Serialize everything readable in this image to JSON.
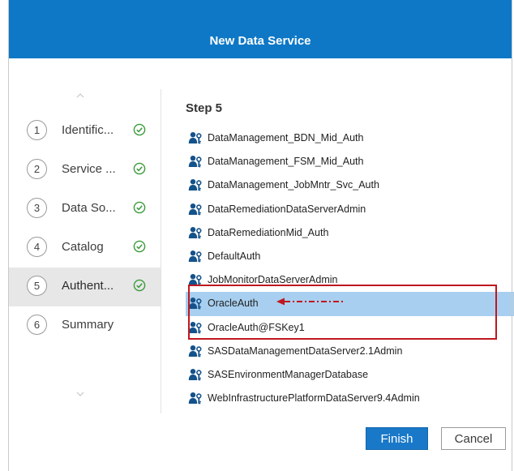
{
  "dialog": {
    "title": "New Data Service"
  },
  "wizard_steps": [
    {
      "number": "1",
      "label": "Identific...",
      "complete": true
    },
    {
      "number": "2",
      "label": "Service ...",
      "complete": true
    },
    {
      "number": "3",
      "label": "Data So...",
      "complete": true
    },
    {
      "number": "4",
      "label": "Catalog",
      "complete": true
    },
    {
      "number": "5",
      "label": "Authent...",
      "complete": true,
      "active": true
    },
    {
      "number": "6",
      "label": "Summary",
      "complete": false
    }
  ],
  "main": {
    "heading": "Step 5",
    "items": [
      "DataManagement_BDN_Mid_Auth",
      "DataManagement_FSM_Mid_Auth",
      "DataManagement_JobMntr_Svc_Auth",
      "DataRemediationDataServerAdmin",
      "DataRemediationMid_Auth",
      "DefaultAuth",
      "JobMonitorDataServerAdmin",
      "OracleAuth",
      "OracleAuth@FSKey1",
      "SASDataManagementDataServer2.1Admin",
      "SASEnvironmentManagerDatabase",
      "WebInfrastructurePlatformDataServer9.4Admin"
    ],
    "selected_item": "OracleAuth"
  },
  "footer": {
    "finish_label": "Finish",
    "cancel_label": "Cancel"
  },
  "colors": {
    "titlebar": "#0e78c6",
    "selected_row": "#a8cfef",
    "annotation": "#c0171f",
    "check": "#3a9a3a"
  },
  "icons": {
    "step_complete": "check-circle-icon",
    "list_item": "user-key-icon",
    "scroll_up": "chevron-up-icon",
    "scroll_down": "chevron-down-icon"
  }
}
